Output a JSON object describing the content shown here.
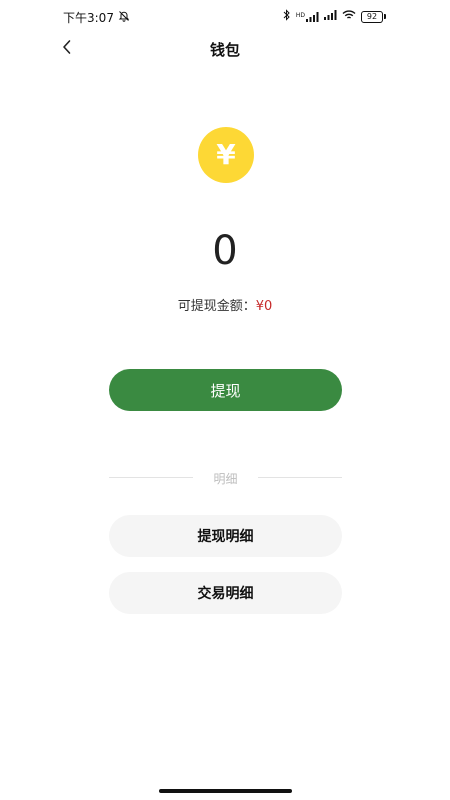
{
  "status_bar": {
    "time": "下午3:07",
    "battery_level": "92",
    "network_badge": "HD",
    "icons": [
      "muted-bell-icon",
      "bluetooth-icon",
      "signal-icon",
      "signal-icon",
      "wifi-icon",
      "battery-icon"
    ]
  },
  "header": {
    "title": "钱包",
    "back_icon": "chevron-left-icon"
  },
  "wallet": {
    "coin_symbol": "¥",
    "coin_color": "#fdd835",
    "balance": "0",
    "withdrawable_label": "可提现金额：",
    "withdrawable_amount": "¥0",
    "withdrawable_amount_color": "#c62828"
  },
  "actions": {
    "withdraw_label": "提现",
    "withdraw_color": "#3a8a41"
  },
  "details": {
    "section_label": "明细",
    "withdraw_detail_label": "提现明细",
    "transaction_detail_label": "交易明细"
  }
}
